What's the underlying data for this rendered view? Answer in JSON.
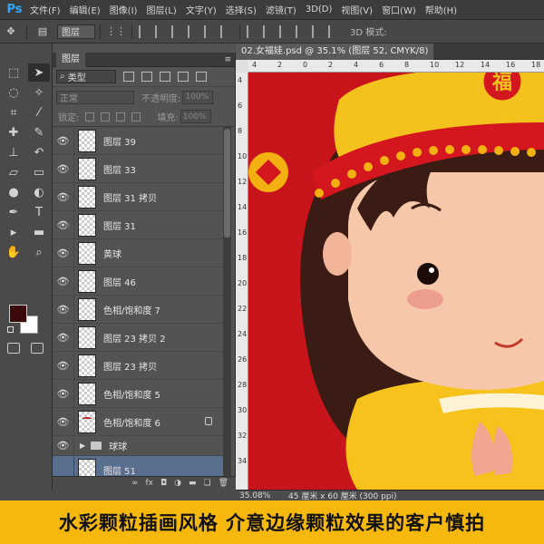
{
  "app": {
    "logo": "Ps"
  },
  "menu": [
    "文件(F)",
    "编辑(E)",
    "图像(I)",
    "图层(L)",
    "文字(Y)",
    "选择(S)",
    "滤镜(T)",
    "3D(D)",
    "视图(V)",
    "窗口(W)",
    "帮助(H)"
  ],
  "options_bar": {
    "layer_select": "图层",
    "mode_3d_label": "3D 模式:"
  },
  "layers_panel": {
    "tab": "图层",
    "filter_type": "类型",
    "blend_mode": "正常",
    "opacity_label": "不透明度:",
    "opacity_value": "100%",
    "lock_label": "锁定:",
    "fill_label": "填充:",
    "fill_value": "100%",
    "layers": [
      {
        "name": "图层 39",
        "visible": true,
        "selected": false,
        "locked": false
      },
      {
        "name": "图层 33",
        "visible": true,
        "selected": false,
        "locked": false
      },
      {
        "name": "图层 31 拷贝",
        "visible": true,
        "selected": false,
        "locked": false
      },
      {
        "name": "图层 31",
        "visible": true,
        "selected": false,
        "locked": false
      },
      {
        "name": "黄球",
        "visible": true,
        "selected": false,
        "locked": false
      },
      {
        "name": "图层 46",
        "visible": true,
        "selected": false,
        "locked": false
      },
      {
        "name": "色相/饱和度 7",
        "visible": true,
        "selected": false,
        "locked": false
      },
      {
        "name": "图层 23 拷贝 2",
        "visible": true,
        "selected": false,
        "locked": false
      },
      {
        "name": "图层 23 拷贝",
        "visible": true,
        "selected": false,
        "locked": false
      },
      {
        "name": "色相/饱和度 5",
        "visible": true,
        "selected": false,
        "locked": false
      },
      {
        "name": "色相/饱和度 6",
        "visible": true,
        "selected": false,
        "locked": true
      }
    ],
    "group": {
      "name": "球球",
      "visible": true
    },
    "bottom_layer": {
      "name": "图层 51",
      "selected": true
    }
  },
  "document": {
    "tab_title": "02.女福娃.psd @ 35.1% (图层 52, CMYK/8)",
    "fu_character": "福",
    "ruler_top": [
      "4",
      "2",
      "0",
      "2",
      "4",
      "6",
      "8",
      "10",
      "12",
      "14",
      "16",
      "18"
    ],
    "ruler_left": [
      "4",
      "6",
      "8",
      "10",
      "12",
      "14",
      "16",
      "18",
      "20",
      "22",
      "24",
      "26",
      "28",
      "30",
      "32",
      "34"
    ]
  },
  "status": {
    "zoom": "35.08%",
    "doc_info": "45 厘米 x 60 厘米 (300 ppi)"
  },
  "banner": {
    "text": "水彩颗粒插画风格  介意边缘颗粒效果的客户慎拍"
  },
  "colors": {
    "foreground": "#3b0a0a",
    "background": "#ffffff",
    "canvas_bg": "#c8151b",
    "banner_bg": "#f7b80d"
  }
}
